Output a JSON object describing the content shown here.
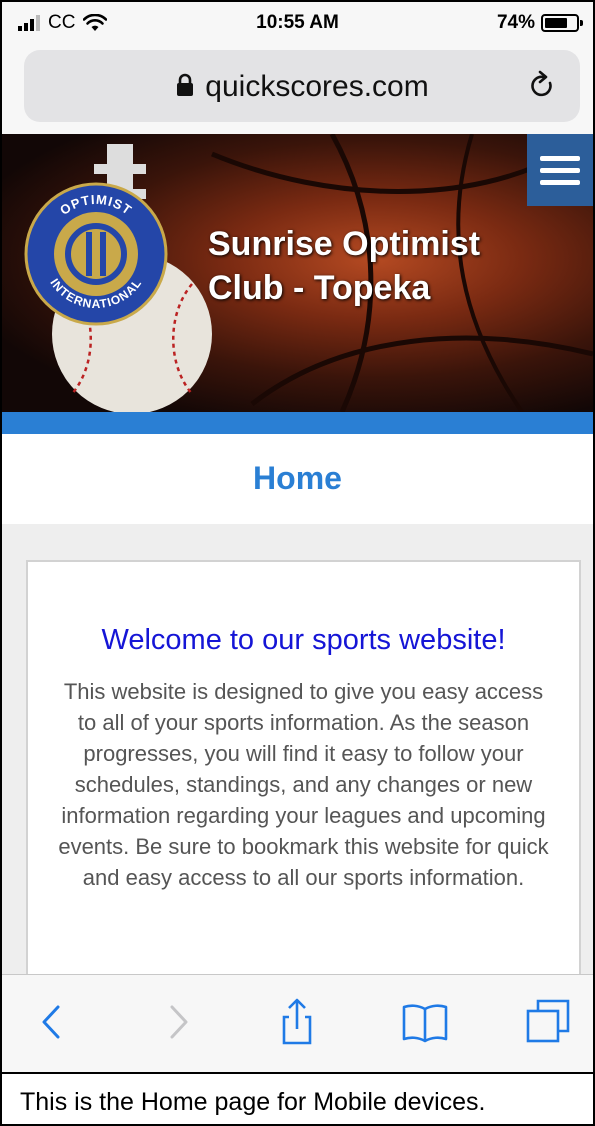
{
  "status_bar": {
    "carrier": "CC",
    "time": "10:55 AM",
    "battery_percent": "74%",
    "battery_level": 0.74,
    "icons": [
      "signal-icon",
      "wifi-icon",
      "battery-icon"
    ]
  },
  "browser": {
    "url": "quickscores.com",
    "icons": [
      "lock-icon",
      "reload-icon"
    ]
  },
  "banner": {
    "club_title": "Sunrise Optimist Club - Topeka",
    "logo_top_text": "OPTIMIST",
    "logo_bottom_text": "INTERNATIONAL"
  },
  "page": {
    "heading": "Home"
  },
  "content": {
    "welcome_title": "Welcome to our sports website!",
    "description": "This website is designed to give you easy access to all of your sports information. As the season progresses, you will find it easy to follow your schedules, standings, and any changes or new information regarding your leagues and upcoming events. Be sure to bookmark this website for quick and easy access to all our sports information."
  },
  "toolbar": {
    "icons": [
      "back-icon",
      "forward-icon",
      "share-icon",
      "bookmarks-icon",
      "tabs-icon"
    ]
  },
  "caption": "This is the Home page for Mobile devices.",
  "colors": {
    "accent_blue": "#2a7fd4",
    "menu_blue": "#2c5e9a",
    "welcome_blue": "#1515d6",
    "ios_blue": "#1f7ae6"
  }
}
